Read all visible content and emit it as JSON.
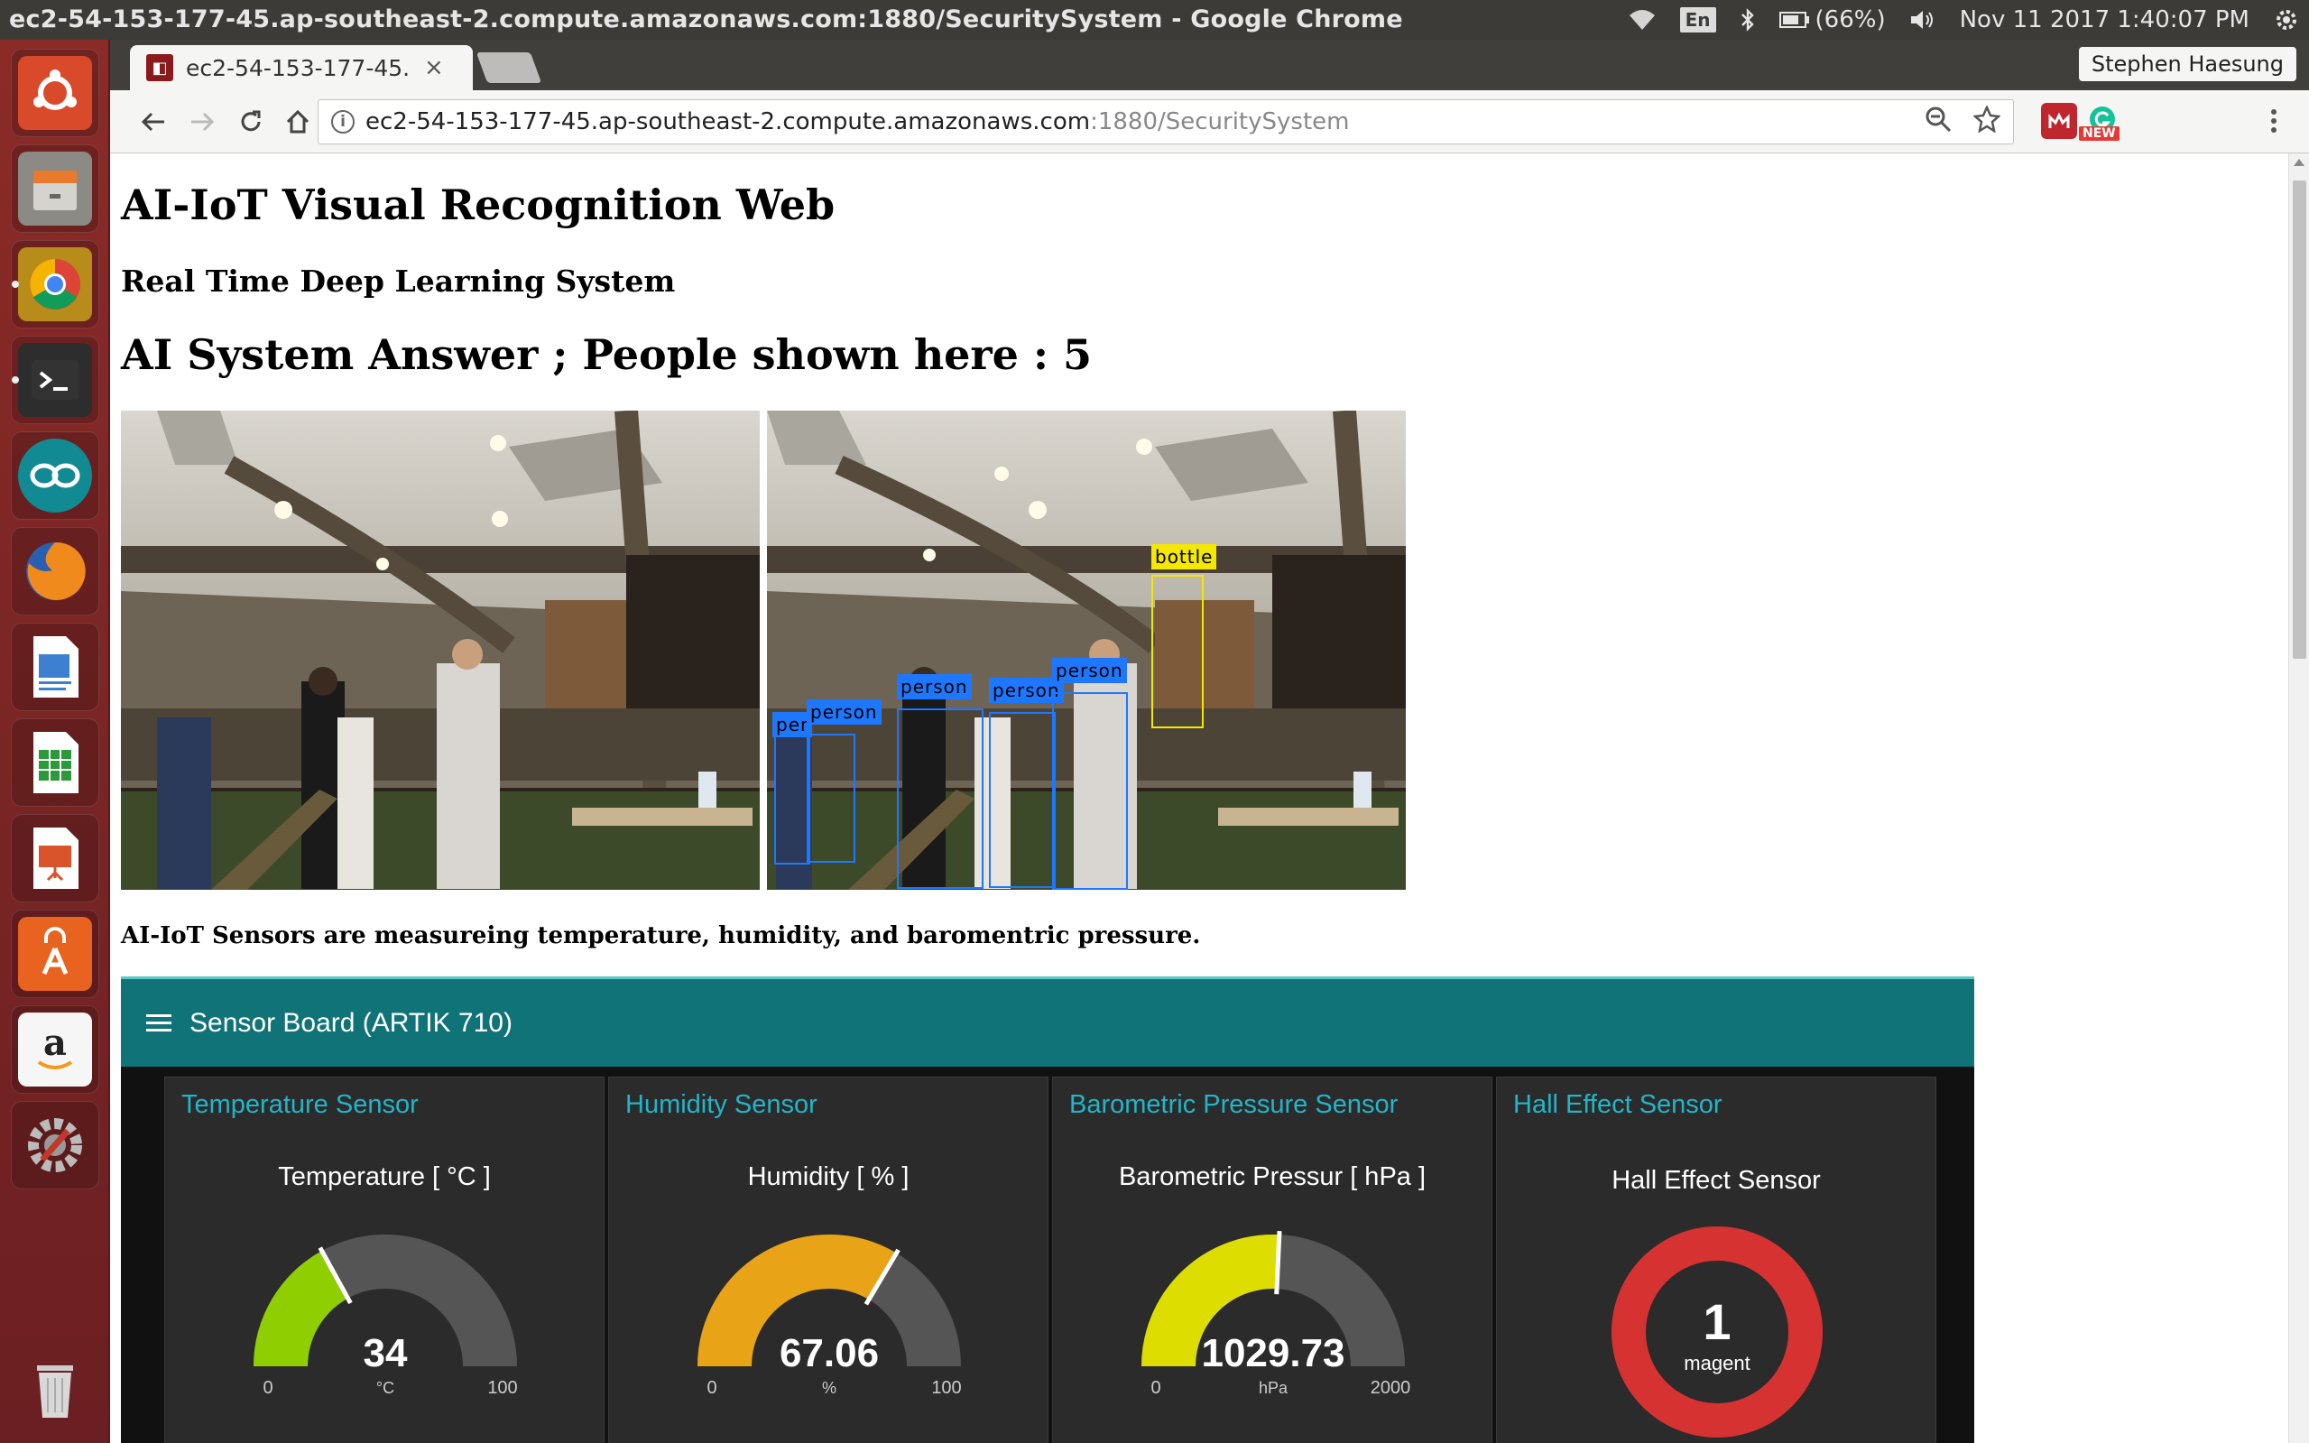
{
  "window": {
    "title": "ec2-54-153-177-45.ap-southeast-2.compute.amazonaws.com:1880/SecuritySystem - Google Chrome",
    "tray": {
      "lang": "En",
      "battery": "(66%)",
      "datetime": "Nov 11 2017  1:40:07 PM"
    }
  },
  "launcher": {
    "items": [
      "ubuntu-dash",
      "files",
      "chrome",
      "terminal",
      "arduino",
      "firefox",
      "libreoffice-writer",
      "libreoffice-calc",
      "libreoffice-impress",
      "software-center",
      "amazon",
      "system-settings",
      "trash"
    ]
  },
  "chrome": {
    "tab_title": "ec2-54-153-177-45.",
    "tab_close": "×",
    "profile": "Stephen Haesung",
    "url_host": "ec2-54-153-177-45.ap-southeast-2.compute.amazonaws.com",
    "url_path": ":1880/SecuritySystem",
    "ext_badge": "NEW"
  },
  "page": {
    "title": "AI-IoT Visual Recognition Web",
    "subtitle": "Real Time Deep Learning System",
    "answer": "AI System Answer ; People shown here : 5",
    "sensor_line": "AI-IoT Sensors are measureing temperature, humidity, and baromentric pressure.",
    "detections": [
      {
        "label": "per",
        "color": "blue"
      },
      {
        "label": "person",
        "color": "blue"
      },
      {
        "label": "person",
        "color": "blue"
      },
      {
        "label": "person",
        "color": "blue"
      },
      {
        "label": "person",
        "color": "blue"
      },
      {
        "label": "bottle",
        "color": "yellow"
      }
    ]
  },
  "dashboard": {
    "title": "Sensor Board (ARTIK 710)",
    "cards": [
      {
        "title": "Temperature Sensor",
        "label": "Temperature [ °C ]",
        "value": "34",
        "unit": "°C",
        "min": "0",
        "max": "100",
        "fraction": 0.34,
        "color": "#8fce00"
      },
      {
        "title": "Humidity Sensor",
        "label": "Humidity [ % ]",
        "value": "67.06",
        "unit": "%",
        "min": "0",
        "max": "100",
        "fraction": 0.6706,
        "color": "#e8a317"
      },
      {
        "title": "Barometric Pressure Sensor",
        "label": "Barometric Pressur [ hPa ]",
        "value": "1029.73",
        "unit": "hPa",
        "min": "0",
        "max": "2000",
        "fraction": 0.5149,
        "color": "#dddd00"
      },
      {
        "title": "Hall Effect Sensor",
        "label": "Hall Effect Sensor",
        "value": "1",
        "unit": "magent",
        "color": "#d63232"
      }
    ]
  }
}
